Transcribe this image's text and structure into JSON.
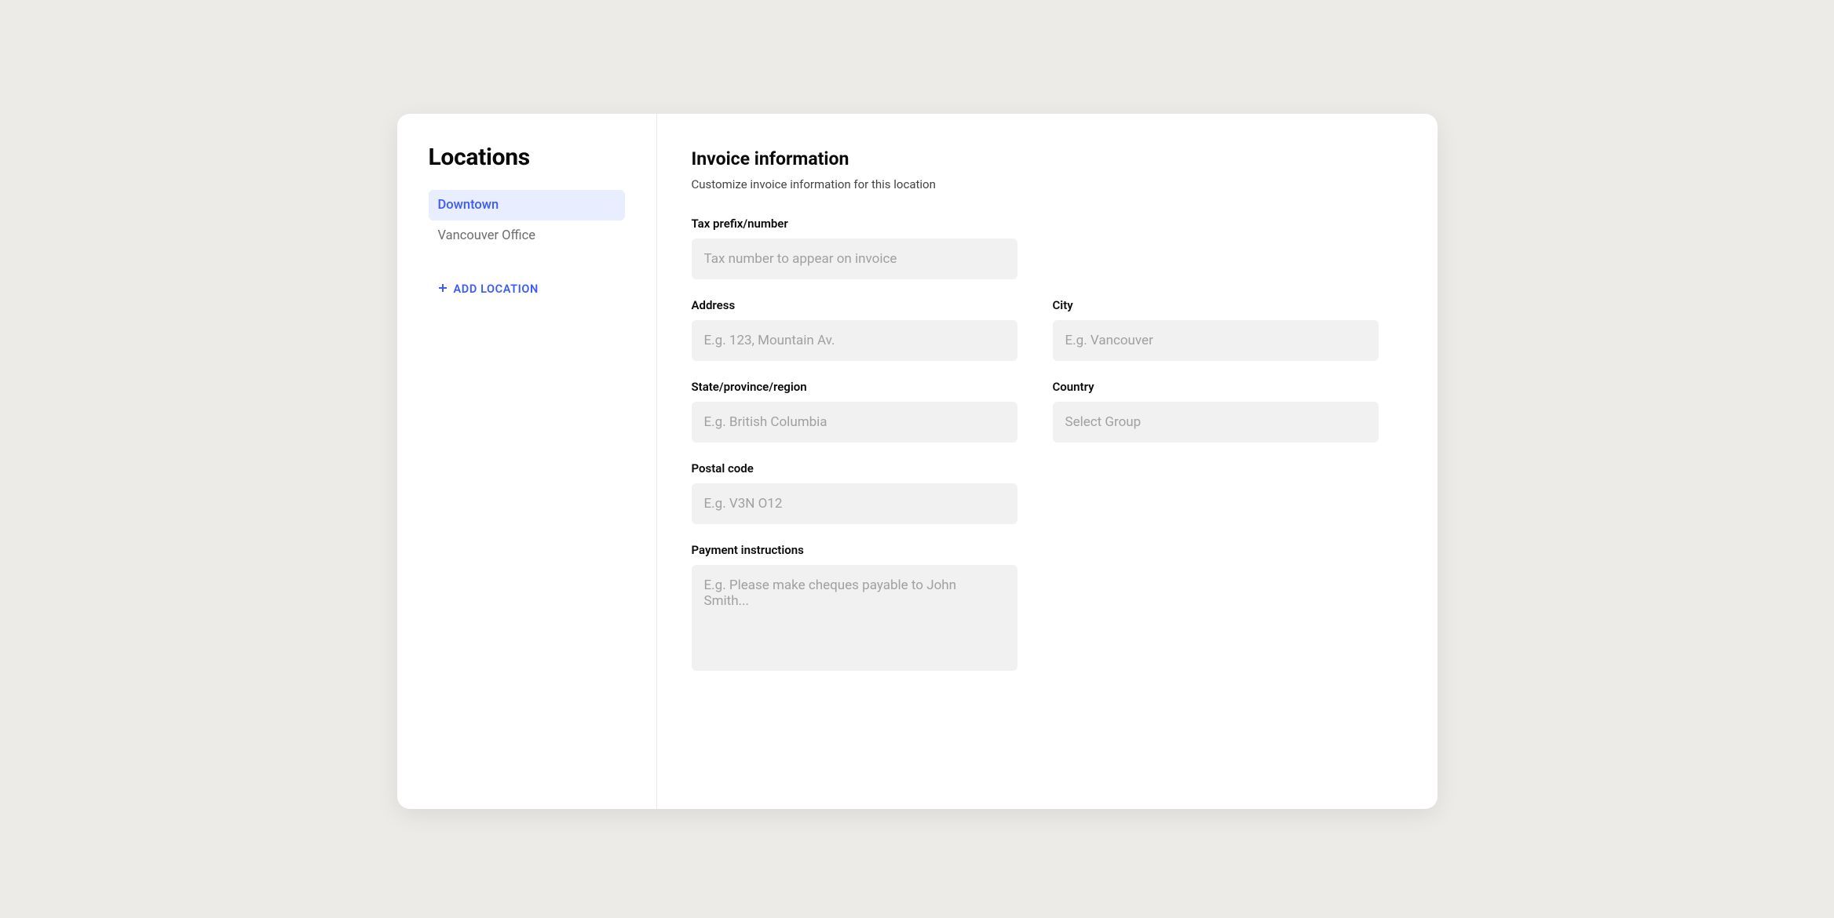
{
  "sidebar": {
    "title": "Locations",
    "items": [
      {
        "label": "Downtown",
        "active": true
      },
      {
        "label": "Vancouver Office",
        "active": false
      }
    ],
    "addLocation": "ADD LOCATION"
  },
  "main": {
    "title": "Invoice information",
    "subtitle": "Customize invoice information for this location",
    "fields": {
      "taxPrefix": {
        "label": "Tax prefix/number",
        "placeholder": "Tax number to appear on invoice"
      },
      "address": {
        "label": "Address",
        "placeholder": "E.g. 123, Mountain Av."
      },
      "city": {
        "label": "City",
        "placeholder": "E.g. Vancouver"
      },
      "state": {
        "label": "State/province/region",
        "placeholder": "E.g. British Columbia"
      },
      "country": {
        "label": "Country",
        "placeholder": "Select Group"
      },
      "postal": {
        "label": "Postal code",
        "placeholder": "E.g. V3N O12"
      },
      "paymentInstructions": {
        "label": "Payment instructions",
        "placeholder": "E.g. Please make cheques payable to John Smith..."
      }
    }
  }
}
